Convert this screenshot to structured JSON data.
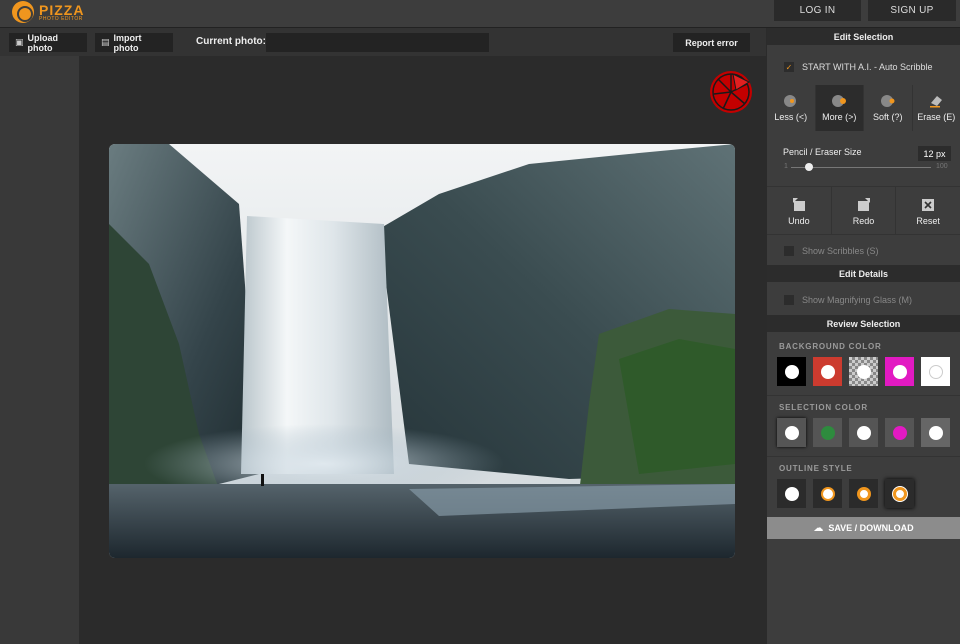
{
  "app": {
    "logo_name": "PIZZA",
    "logo_sub": "PHOTO EDITOR",
    "accent_color": "#f0961e"
  },
  "header": {
    "login": "LOG IN",
    "signup": "SIGN UP"
  },
  "toolbar": {
    "upload": "Upload photo",
    "import": "Import photo",
    "current_photo_label": "Current photo:",
    "current_photo_value": "",
    "report": "Report error"
  },
  "canvas": {
    "image_icon": "pizza-logo-icon"
  },
  "panel": {
    "edit_selection": "Edit Selection",
    "ai_scribble": {
      "label": "START WITH A.I. - Auto Scribble",
      "checked": true
    },
    "tools": [
      {
        "label": "Less (<)",
        "icon": "less-scribble-icon",
        "active": false
      },
      {
        "label": "More (>)",
        "icon": "more-scribble-icon",
        "active": true
      },
      {
        "label": "Soft (?)",
        "icon": "soft-scribble-icon",
        "active": false
      },
      {
        "label": "Erase (E)",
        "icon": "eraser-icon",
        "active": false
      }
    ],
    "size": {
      "label": "Pencil / Eraser Size",
      "value": "12 px",
      "min": "1",
      "max": "100",
      "level": 12
    },
    "history": [
      {
        "label": "Undo",
        "icon": "undo-icon"
      },
      {
        "label": "Redo",
        "icon": "redo-icon"
      },
      {
        "label": "Reset",
        "icon": "reset-icon"
      }
    ],
    "show_scribbles": "Show Scribbles (S)",
    "edit_details": "Edit Details",
    "show_magnifier": "Show Magnifying Glass (M)",
    "review_selection": "Review Selection",
    "background_color_label": "BACKGROUND COLOR",
    "background_colors": [
      "#000000",
      "#cc3b2f",
      "checker",
      "#e21ac2",
      "#ffffff"
    ],
    "selection_color_label": "SELECTION COLOR",
    "selection_colors": [
      "#555555",
      "#2e8b3e",
      "checker",
      "#e21ac2",
      "#666666"
    ],
    "outline_style_label": "OUTLINE STYLE",
    "save": "SAVE / DOWNLOAD"
  }
}
